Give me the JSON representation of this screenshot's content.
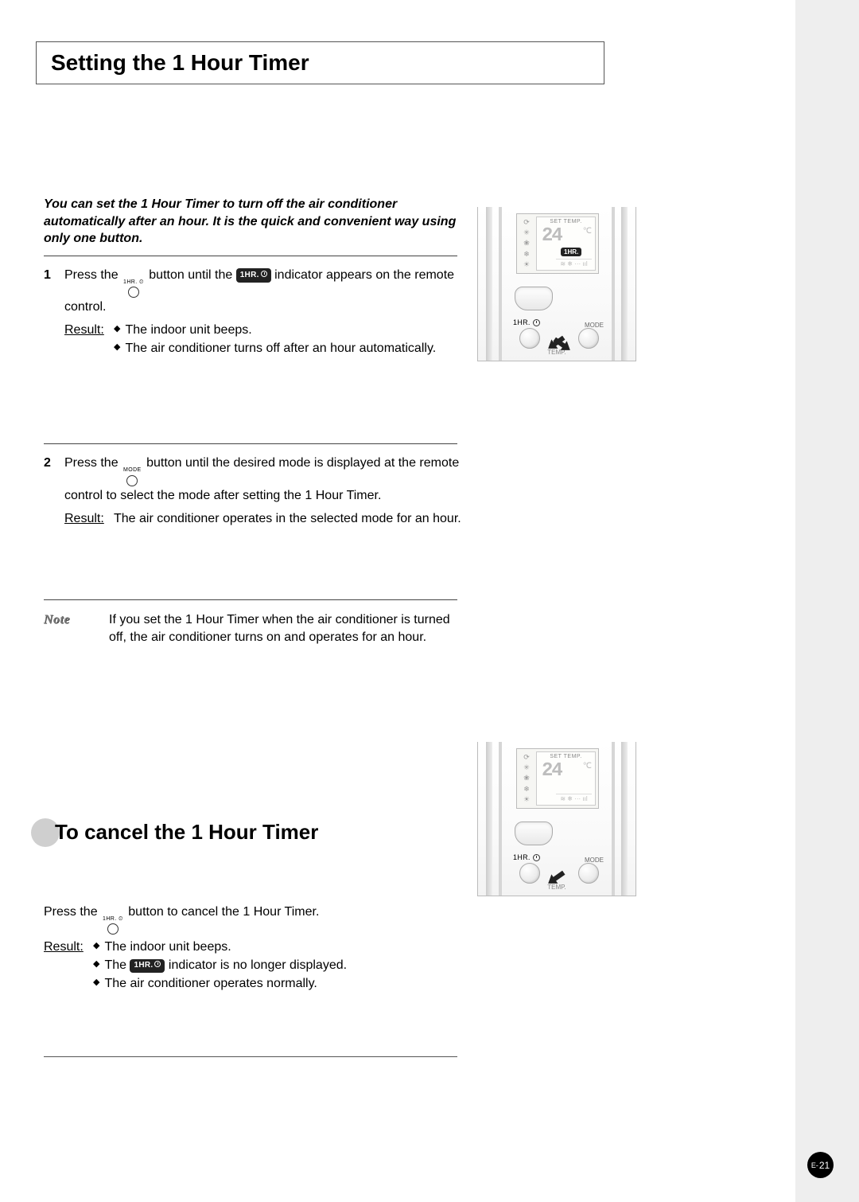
{
  "title": "Setting the 1 Hour Timer",
  "intro": "You can set the 1 Hour Timer to turn off the air conditioner automatically after an hour. It is the quick and convenient way using only one button.",
  "icons": {
    "hr_btn_label": "1HR.",
    "mode_btn_label": "MODE",
    "indicator_pill": "1HR."
  },
  "steps": [
    {
      "num": "1",
      "press_pre": "Press the ",
      "press_post": " button until the ",
      "press_tail": " indicator appears on the remote control.",
      "result_label": "Result:",
      "bullets": [
        "The indoor unit beeps.",
        "The air conditioner turns off after an hour automatically."
      ]
    },
    {
      "num": "2",
      "press_pre": "Press the ",
      "press_post": " button until the desired mode is displayed at the remote control to select the mode after setting the 1 Hour Timer.",
      "result_label": "Result:",
      "result_text": "The air conditioner operates in the selected mode for an hour."
    }
  ],
  "note": {
    "label": "Note",
    "text": "If you set the 1 Hour Timer when the air conditioner is turned off, the air conditioner turns on and operates for an hour."
  },
  "sub_title_prefix": "To",
  "sub_title_rest": " cancel the 1 Hour Timer",
  "cancel": {
    "press_pre": "Press the ",
    "press_post": " button to cancel the 1 Hour Timer.",
    "result_label": "Result:",
    "bullets_pre": "The indoor unit beeps.",
    "bullet2_pre": "The ",
    "bullet2_post": " indicator is no longer displayed.",
    "bullet3": "The air conditioner operates normally."
  },
  "remote": {
    "settemp": "SET TEMP.",
    "temp_digits": "24",
    "temp_unit": "℃",
    "hr_label": "1HR.",
    "mode_label": "MODE",
    "temp_label": "TEMP.",
    "mode_icons": [
      "⟳",
      "✳",
      "❀",
      "❄",
      "☀"
    ],
    "air_icons": "≋ ❄ ··· ııl"
  },
  "page_number": {
    "prefix": "E-",
    "num": "21"
  }
}
